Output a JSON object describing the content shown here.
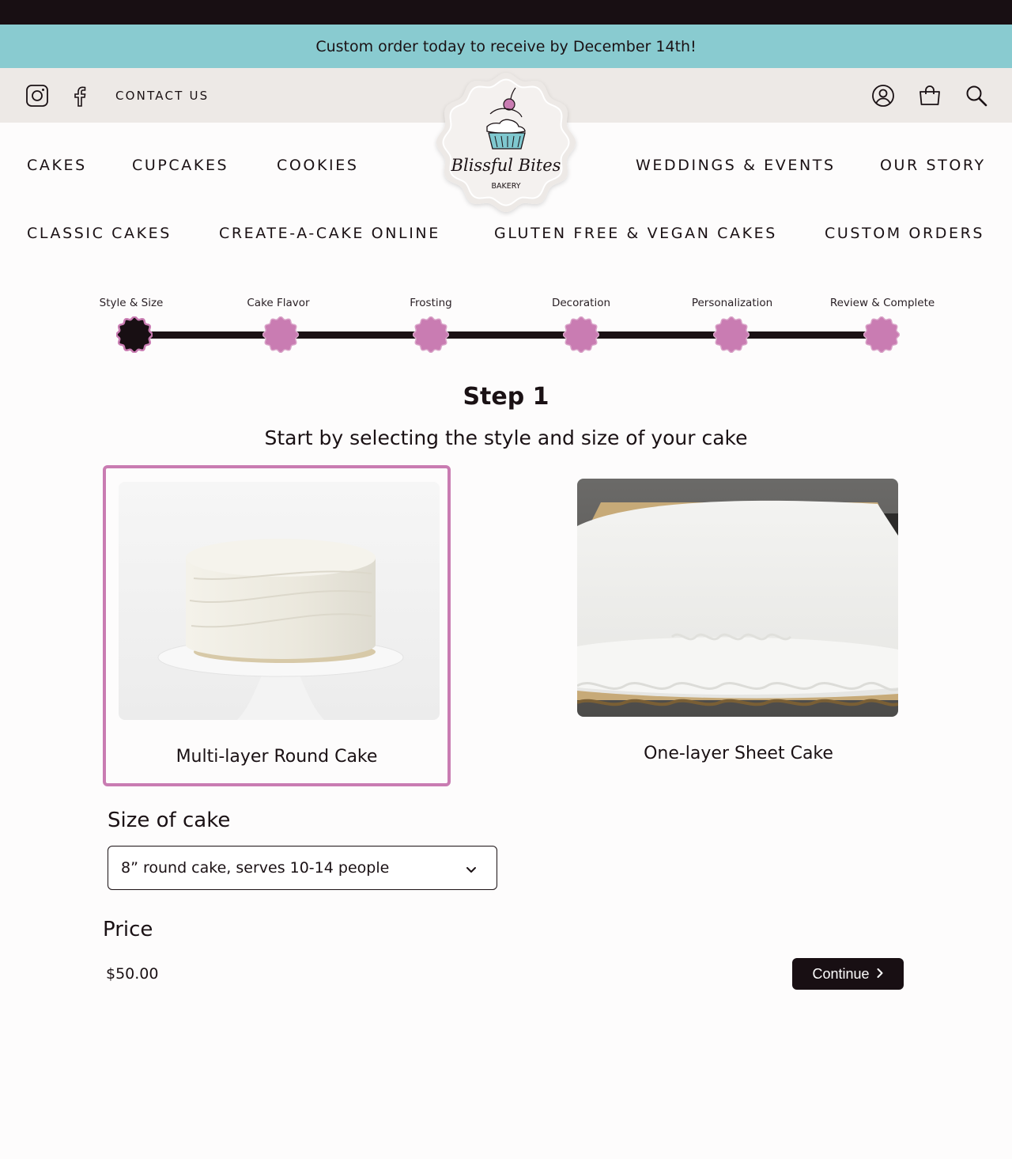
{
  "promo": {
    "text": "Custom order today to receive by December 14th!"
  },
  "utility": {
    "contact_label": "CONTACT US",
    "icons_left": [
      "instagram-icon",
      "facebook-icon"
    ],
    "icons_right": [
      "account-icon",
      "cart-icon",
      "search-icon"
    ]
  },
  "logo": {
    "script_text": "Blissful Bites",
    "subtitle": "BAKERY"
  },
  "nav": {
    "primary_left": [
      "CAKES",
      "CUPCAKES",
      "COOKIES"
    ],
    "primary_right": [
      "WEDDINGS & EVENTS",
      "OUR STORY"
    ],
    "secondary": [
      "CLASSIC CAKES",
      "CREATE-A-CAKE ONLINE",
      "GLUTEN FREE & VEGAN CAKES",
      "CUSTOM ORDERS"
    ]
  },
  "steps": {
    "items": [
      "Style & Size",
      "Cake Flavor",
      "Frosting",
      "Decoration",
      "Personalization",
      "Review & Complete"
    ],
    "current_index": 0
  },
  "heading": {
    "step": "Step 1",
    "subtitle": "Start by selecting the style and size of your cake"
  },
  "options": [
    {
      "title": "Multi-layer Round Cake",
      "selected": true
    },
    {
      "title": "One-layer Sheet Cake",
      "selected": false
    }
  ],
  "size": {
    "label": "Size of cake",
    "selected_value": "8” round cake, serves 10-14 people"
  },
  "price": {
    "label": "Price",
    "value": "$50.00"
  },
  "continue_label": "Continue",
  "colors": {
    "accent_pink": "#c97cb2",
    "dark": "#180f13",
    "promo_teal": "#89cbd0",
    "utility_bg": "#ede9e6"
  }
}
